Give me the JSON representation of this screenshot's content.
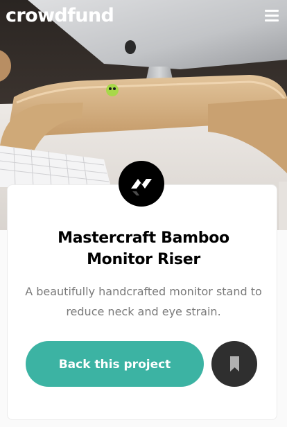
{
  "header": {
    "logo_text": "crowdfund",
    "menu_icon": "hamburger-menu-icon"
  },
  "hero": {
    "image_icon": "desk-monitor-riser-photo"
  },
  "project": {
    "brand_icon": "mastercraft-logo-icon",
    "title_lines": [
      "Mastercraft Bamboo",
      "Monitor Riser"
    ],
    "description_lines": [
      "A beautifully handcrafted monitor stand to",
      "reduce neck and eye strain."
    ]
  },
  "actions": {
    "back_label": "Back this project",
    "bookmark_icon": "bookmark-icon"
  },
  "colors": {
    "accent": "#3cb3a3",
    "bookmark_bg": "#2f2f2f",
    "title": "#000000",
    "description": "#7a7a7a"
  }
}
